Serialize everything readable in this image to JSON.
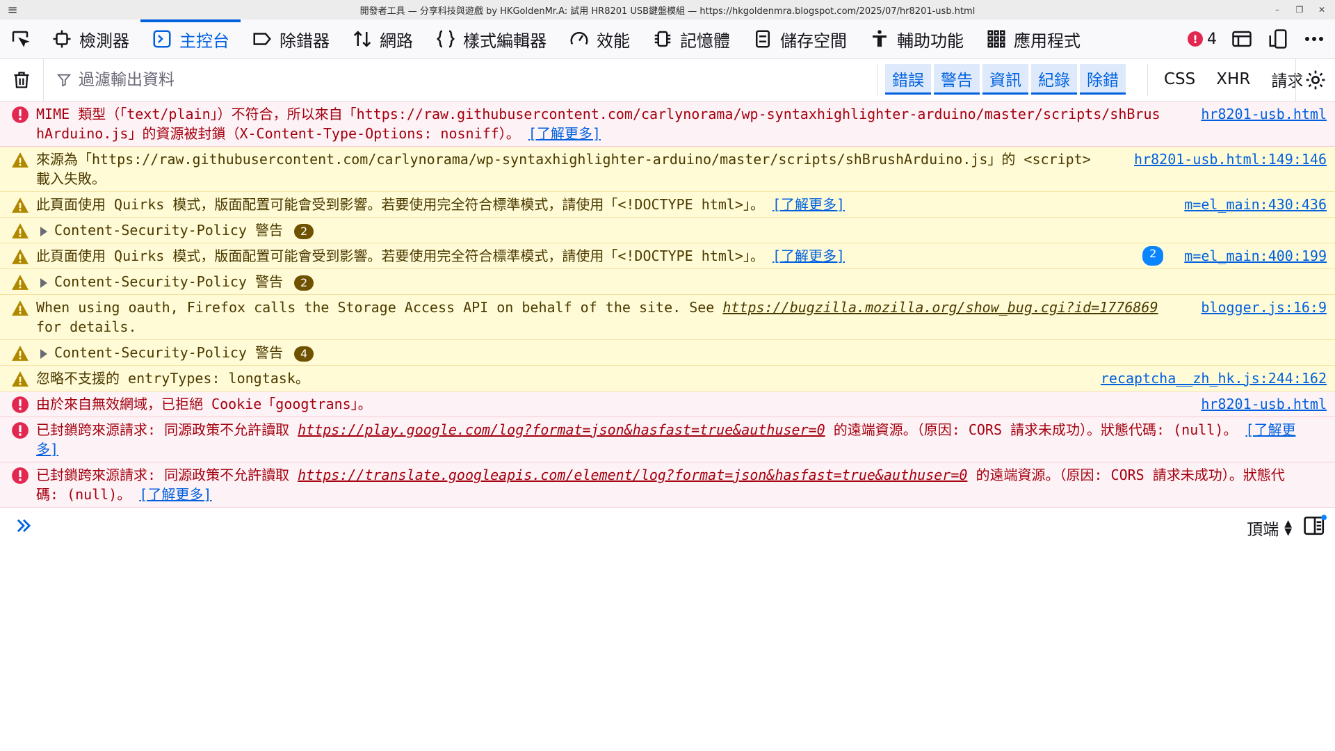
{
  "window": {
    "title": "開發者工具 — 分享科技與遊戲 by HKGoldenMr.A: 試用 HR8201 USB鍵盤模組 — https://hkgoldenmra.blogspot.com/2025/07/hr8201-usb.html"
  },
  "toolbar": {
    "tabs": [
      {
        "label": "檢測器",
        "icon": "inspector-icon"
      },
      {
        "label": "主控台",
        "icon": "console-icon",
        "active": true
      },
      {
        "label": "除錯器",
        "icon": "debugger-icon"
      },
      {
        "label": "網路",
        "icon": "network-icon"
      },
      {
        "label": "樣式編輯器",
        "icon": "style-editor-icon"
      },
      {
        "label": "效能",
        "icon": "performance-icon"
      },
      {
        "label": "記憶體",
        "icon": "memory-icon"
      },
      {
        "label": "儲存空間",
        "icon": "storage-icon"
      },
      {
        "label": "輔助功能",
        "icon": "accessibility-icon"
      },
      {
        "label": "應用程式",
        "icon": "application-icon"
      }
    ],
    "error_count": "4"
  },
  "filter": {
    "placeholder": "過濾輸出資料",
    "levels": [
      "錯誤",
      "警告",
      "資訊",
      "紀錄",
      "除錯"
    ],
    "types": [
      "CSS",
      "XHR",
      "請求"
    ]
  },
  "messages": [
    {
      "level": "error",
      "text": "MIME 類型（「text/plain」）不符合，所以來自「https://raw.githubusercontent.com/carlynorama/wp-syntaxhighlighter-arduino/master/scripts/shBrushArduino.js」的資源被封鎖（X-Content-Type-Options: nosniff）。",
      "learn_more": "[了解更多]",
      "source": "hr8201-usb.html"
    },
    {
      "level": "warn",
      "text": "來源為「https://raw.githubusercontent.com/carlynorama/wp-syntaxhighlighter-arduino/master/scripts/shBrushArduino.js」的 <script> 載入失敗。",
      "source": "hr8201-usb.html:149:146"
    },
    {
      "level": "warn",
      "text": "此頁面使用 Quirks 模式，版面配置可能會受到影響。若要使用完全符合標準模式，請使用「<!DOCTYPE html>」。",
      "learn_more": "[了解更多]",
      "source": "m=el_main:430:436"
    },
    {
      "level": "warn",
      "group": true,
      "text": "Content-Security-Policy 警告",
      "badge": "2"
    },
    {
      "level": "warn",
      "text": "此頁面使用 Quirks 模式，版面配置可能會受到影響。若要使用完全符合標準模式，請使用「<!DOCTYPE html>」。",
      "learn_more": "[了解更多]",
      "repeat": "2",
      "source": "m=el_main:400:199"
    },
    {
      "level": "warn",
      "group": true,
      "text": "Content-Security-Policy 警告",
      "badge": "2"
    },
    {
      "level": "warn",
      "text_pre": "When using oauth, Firefox calls the Storage Access API on behalf of the site. See ",
      "url": "https://bugzilla.mozilla.org/show_bug.cgi?id=1776869",
      "text_post": " for details.",
      "source": "blogger.js:16:9"
    },
    {
      "level": "warn",
      "group": true,
      "text": "Content-Security-Policy 警告",
      "badge": "4"
    },
    {
      "level": "warn",
      "text": "忽略不支援的 entryTypes: longtask。",
      "source": "recaptcha__zh_hk.js:244:162"
    },
    {
      "level": "error",
      "text": "由於來自無效網域，已拒絕 Cookie「googtrans」。",
      "source": "hr8201-usb.html"
    },
    {
      "level": "error",
      "text_pre": "已封鎖跨來源請求: 同源政策不允許讀取 ",
      "url": "https://play.google.com/log?format=json&hasfast=true&authuser=0",
      "text_post": " 的遠端資源。（原因: CORS 請求未成功）。狀態代碼: (null)。",
      "learn_more": "[了解更多]"
    },
    {
      "level": "error",
      "text_pre": "已封鎖跨來源請求: 同源政策不允許讀取 ",
      "url": "https://translate.googleapis.com/element/log?format=json&hasfast=true&authuser=0",
      "text_post": " 的遠端資源。（原因: CORS 請求未成功）。狀態代碼: (null)。",
      "learn_more": "[了解更多]"
    }
  ],
  "input": {
    "context": "頂端"
  },
  "colors": {
    "accent": "#0061e0",
    "error_bg": "#fdf2f5",
    "warn_bg": "#fffbd6"
  }
}
